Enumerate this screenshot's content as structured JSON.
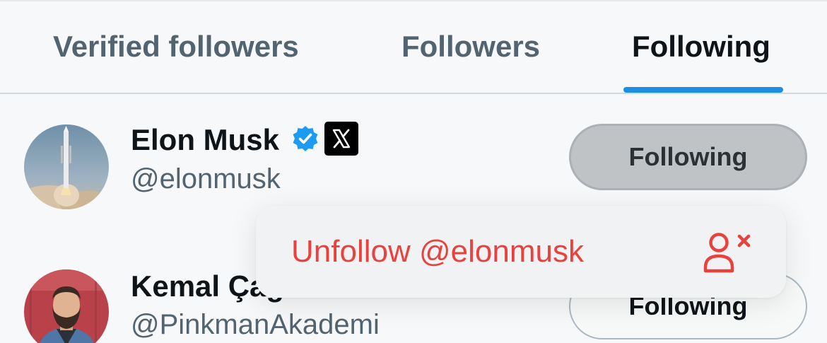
{
  "tabs": [
    {
      "label": "Verified followers",
      "active": false
    },
    {
      "label": "Followers",
      "active": false
    },
    {
      "label": "Following",
      "active": true
    }
  ],
  "accounts": [
    {
      "name": "Elon Musk",
      "handle": "@elonmusk",
      "verified": true,
      "affiliate_badge": "x-logo-icon",
      "button_label": "Following",
      "button_state": "pressed"
    },
    {
      "name": "Kemal Çağ",
      "handle": "@PinkmanAkademi",
      "verified": false,
      "button_label": "Following",
      "button_state": "default"
    }
  ],
  "context_menu": {
    "item_label": "Unfollow @elonmusk",
    "item_icon": "remove-user-icon"
  },
  "colors": {
    "accent_blue": "#1d9bf0",
    "tab_indicator": "#1d8fe0",
    "destructive_red": "#e8423f",
    "text_primary": "#0f1419",
    "text_secondary": "#536471"
  }
}
